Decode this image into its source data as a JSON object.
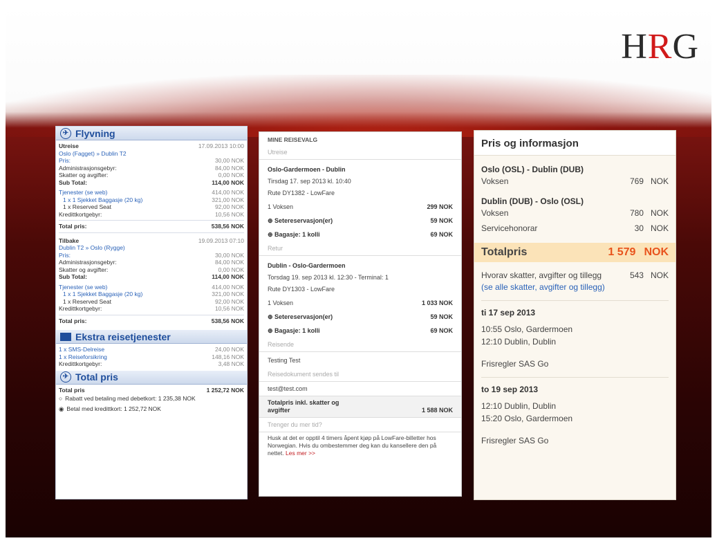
{
  "logo": {
    "left": "H",
    "mid": "R",
    "right": "G"
  },
  "panel1": {
    "flight_head": "Flyvning",
    "extra_head": "Ekstra reisetjenester",
    "total_head": "Total pris",
    "outbound": {
      "title": "Utreise",
      "date": "17.09.2013 10:00",
      "route": "Oslo (Fagget) » Dublin T2",
      "rows": [
        {
          "label": "Pris:",
          "value": "30,00 NOK",
          "cls": "blue"
        },
        {
          "label": "Administrasjonsgebyr:",
          "value": "84,00 NOK",
          "cls": ""
        },
        {
          "label": "Skatter og avgifter:",
          "value": "0,00 NOK",
          "cls": ""
        }
      ],
      "subtotal_label": "Sub Total:",
      "subtotal_value": "114,00 NOK",
      "services_label": "Tjenester (se web)",
      "services_value": "414,00 NOK",
      "bag_label": "1 x 1 Sjekket Baggasje (20 kg)",
      "bag_value": "321,00 NOK",
      "seat_label": "1 x Reserved Seat",
      "seat_value": "92,00 NOK",
      "card_label": "Kredittkortgebyr:",
      "card_value": "10,56 NOK",
      "total_label": "Total pris:",
      "total_value": "538,56 NOK"
    },
    "inbound": {
      "title": "Tilbake",
      "date": "19.09.2013 07:10",
      "route": "Dublin T2 » Oslo (Rygge)",
      "rows": [
        {
          "label": "Pris:",
          "value": "30,00 NOK",
          "cls": "blue"
        },
        {
          "label": "Administrasjonsgebyr:",
          "value": "84,00 NOK",
          "cls": ""
        },
        {
          "label": "Skatter og avgifter:",
          "value": "0,00 NOK",
          "cls": ""
        }
      ],
      "subtotal_label": "Sub Total:",
      "subtotal_value": "114,00 NOK",
      "services_label": "Tjenester (se web)",
      "services_value": "414,00 NOK",
      "bag_label": "1 x 1 Sjekket Baggasje (20 kg)",
      "bag_value": "321,00 NOK",
      "seat_label": "1 x Reserved Seat",
      "seat_value": "92,00 NOK",
      "card_label": "Kredittkortgebyr:",
      "card_value": "10,56 NOK",
      "total_label": "Total pris:",
      "total_value": "538,56 NOK"
    },
    "extras": [
      {
        "label": "1 x SMS-Delreise",
        "value": "24,00 NOK"
      },
      {
        "label": "1 x Reiseforsikring",
        "value": "148,16 NOK"
      },
      {
        "label": "Kredittkortgebyr:",
        "value": "3,48 NOK"
      }
    ],
    "grand_label": "Total pris",
    "grand_value": "1 252,72 NOK",
    "option1": "Rabatt ved betaling med debetkort: 1 235,38 NOK",
    "option2": "Betal med kredittkort: 1 252,72 NOK"
  },
  "panel2": {
    "title": "MINE REISEVALG",
    "out_sub": "Utreise",
    "out_route": "Oslo-Gardermoen - Dublin",
    "out_time": "Tirsdag 17. sep 2013 kl. 10:40",
    "out_flight": "Rute DY1382 - LowFare",
    "out_pax": "1 Voksen",
    "out_pax_price": "299 NOK",
    "out_seat": "Setereservasjon(er)",
    "out_seat_price": "59 NOK",
    "out_bag": "Bagasje: 1 kolli",
    "out_bag_price": "69 NOK",
    "ret_sub": "Retur",
    "ret_route": "Dublin - Oslo-Gardermoen",
    "ret_time": "Torsdag 19. sep 2013 kl. 12:30 - Terminal: 1",
    "ret_flight": "Rute DY1303 - LowFare",
    "ret_pax": "1 Voksen",
    "ret_pax_price": "1 033 NOK",
    "ret_seat": "Setereservasjon(er)",
    "ret_seat_price": "59 NOK",
    "ret_bag": "Bagasje: 1 kolli",
    "ret_bag_price": "69 NOK",
    "pax_sub": "Reisende",
    "pax_name": "Testing Test",
    "doc_sub": "Reisedokument sendes til",
    "email": "test@test.com",
    "total_label": "Totalpris inkl. skatter og avgifter",
    "total_value": "1 588 NOK",
    "note_sub": "Trenger du mer tid?",
    "note": "Husk at det er opptil 4 timers åpent kjøp på LowFare-billetter hos Norwegian. Hvis du ombestemmer deg kan du kansellere den på nettet.",
    "read_more": "Les mer >>"
  },
  "panel3": {
    "title": "Pris og informasjon",
    "route1": "Oslo (OSL) - Dublin (DUB)",
    "r1_label": "Voksen",
    "r1_num": "769",
    "r1_cur": "NOK",
    "route2": "Dublin (DUB) - Oslo (OSL)",
    "r2_label": "Voksen",
    "r2_num": "780",
    "r2_cur": "NOK",
    "svc_label": "Servicehonorar",
    "svc_num": "30",
    "svc_cur": "NOK",
    "total_label": "Totalpris",
    "total_num": "1 579",
    "total_cur": "NOK",
    "tax_label": "Hvorav skatter, avgifter og tillegg",
    "tax_num": "543",
    "tax_cur": "NOK",
    "tax_link": "(se alle skatter, avgifter og tillegg)",
    "date1": "ti 17 sep 2013",
    "d1_line1": "10:55  Oslo, Gardermoen",
    "d1_line2": "12:10  Dublin, Dublin",
    "rules1": "Frisregler  SAS Go",
    "date2": "to 19 sep 2013",
    "d2_line1": "12:10  Dublin, Dublin",
    "d2_line2": "15:20  Oslo, Gardermoen",
    "rules2": "Frisregler  SAS Go"
  }
}
